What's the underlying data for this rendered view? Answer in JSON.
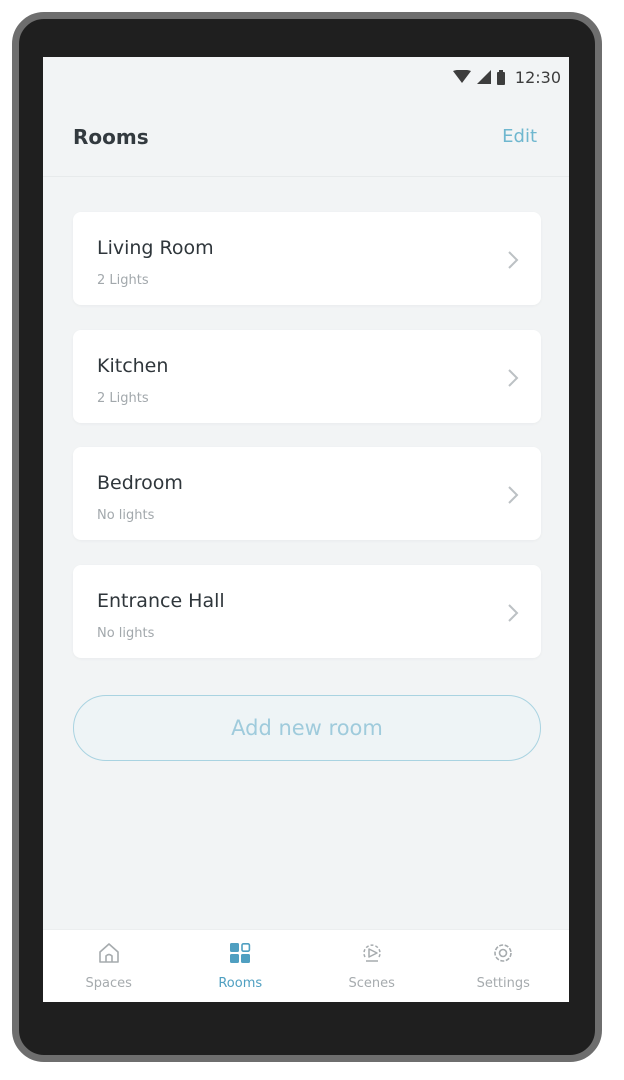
{
  "status_bar": {
    "time": "12:30",
    "icons": [
      "wifi-icon",
      "signal-icon",
      "battery-icon"
    ]
  },
  "header": {
    "title": "Rooms",
    "edit_label": "Edit"
  },
  "rooms": [
    {
      "name": "Living Room",
      "subtitle": "2 Lights"
    },
    {
      "name": "Kitchen",
      "subtitle": "2 Lights"
    },
    {
      "name": "Bedroom",
      "subtitle": "No lights"
    },
    {
      "name": "Entrance Hall",
      "subtitle": "No lights"
    }
  ],
  "add_room": {
    "label": "Add new room"
  },
  "bottom_nav": {
    "items": [
      {
        "label": "Spaces",
        "icon": "home-icon"
      },
      {
        "label": "Rooms",
        "icon": "rooms-grid-icon",
        "active": true
      },
      {
        "label": "Scenes",
        "icon": "scenes-icon"
      },
      {
        "label": "Settings",
        "icon": "gear-icon"
      }
    ]
  },
  "colors": {
    "accent": "#4f9fc1",
    "edit": "#6fb7cf",
    "background": "#f2f4f5",
    "card": "#ffffff",
    "add_button_border": "#a9d3e1"
  }
}
